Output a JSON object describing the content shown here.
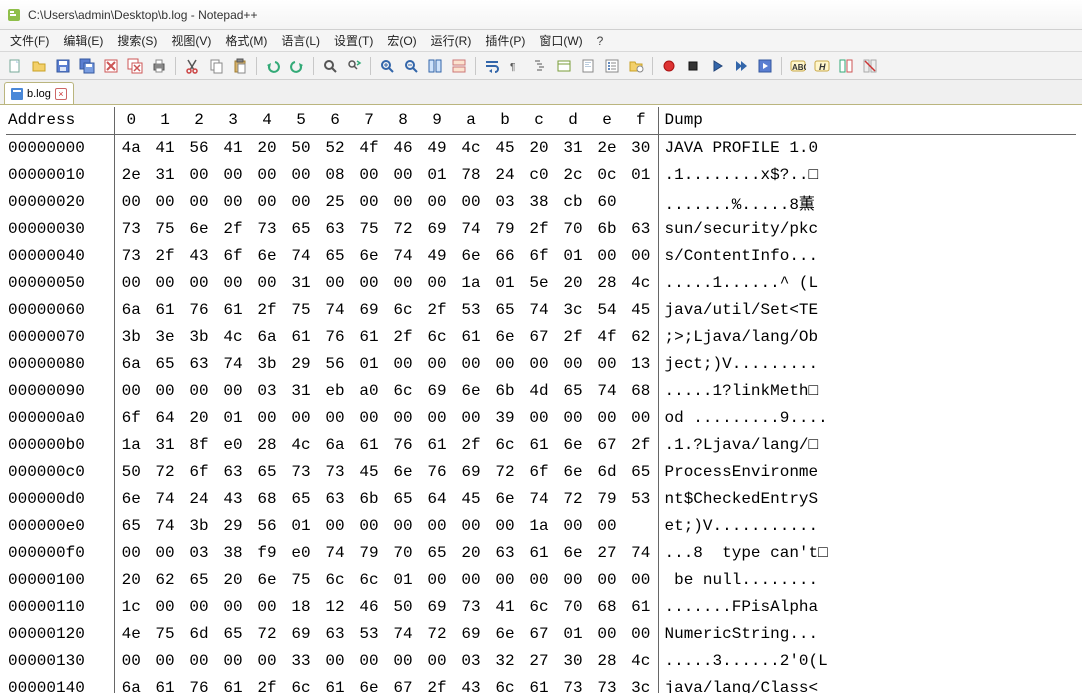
{
  "window": {
    "title": "C:\\Users\\admin\\Desktop\\b.log - Notepad++"
  },
  "menu": [
    "文件(F)",
    "编辑(E)",
    "搜索(S)",
    "视图(V)",
    "格式(M)",
    "语言(L)",
    "设置(T)",
    "宏(O)",
    "运行(R)",
    "插件(P)",
    "窗口(W)",
    "?"
  ],
  "tab": {
    "label": "b.log",
    "close": "×"
  },
  "hex": {
    "header": {
      "address": "Address",
      "cols": [
        "0",
        "1",
        "2",
        "3",
        "4",
        "5",
        "6",
        "7",
        "8",
        "9",
        "a",
        "b",
        "c",
        "d",
        "e",
        "f"
      ],
      "dump": "Dump"
    },
    "rows": [
      {
        "addr": "00000000",
        "hex": [
          "4a",
          "41",
          "56",
          "41",
          "20",
          "50",
          "52",
          "4f",
          "46",
          "49",
          "4c",
          "45",
          "20",
          "31",
          "2e",
          "30"
        ],
        "dump": "JAVA PROFILE 1.0"
      },
      {
        "addr": "00000010",
        "hex": [
          "2e",
          "31",
          "00",
          "00",
          "00",
          "00",
          "08",
          "00",
          "00",
          "01",
          "78",
          "24",
          "c0",
          "2c",
          "0c",
          "01"
        ],
        "dump": ".1........x$?..□"
      },
      {
        "addr": "00000020",
        "hex": [
          "00",
          "00",
          "00",
          "00",
          "00",
          "00",
          "25",
          "00",
          "00",
          "00",
          "00",
          "03",
          "38",
          "cb",
          "60"
        ],
        "dump": ".......%.....8薫"
      },
      {
        "addr": "00000030",
        "hex": [
          "73",
          "75",
          "6e",
          "2f",
          "73",
          "65",
          "63",
          "75",
          "72",
          "69",
          "74",
          "79",
          "2f",
          "70",
          "6b",
          "63"
        ],
        "dump": "sun/security/pkc"
      },
      {
        "addr": "00000040",
        "hex": [
          "73",
          "2f",
          "43",
          "6f",
          "6e",
          "74",
          "65",
          "6e",
          "74",
          "49",
          "6e",
          "66",
          "6f",
          "01",
          "00",
          "00"
        ],
        "dump": "s/ContentInfo..."
      },
      {
        "addr": "00000050",
        "hex": [
          "00",
          "00",
          "00",
          "00",
          "00",
          "31",
          "00",
          "00",
          "00",
          "00",
          "1a",
          "01",
          "5e",
          "20",
          "28",
          "4c"
        ],
        "dump": ".....1......^ (L"
      },
      {
        "addr": "00000060",
        "hex": [
          "6a",
          "61",
          "76",
          "61",
          "2f",
          "75",
          "74",
          "69",
          "6c",
          "2f",
          "53",
          "65",
          "74",
          "3c",
          "54",
          "45"
        ],
        "dump": "java/util/Set<TE"
      },
      {
        "addr": "00000070",
        "hex": [
          "3b",
          "3e",
          "3b",
          "4c",
          "6a",
          "61",
          "76",
          "61",
          "2f",
          "6c",
          "61",
          "6e",
          "67",
          "2f",
          "4f",
          "62"
        ],
        "dump": ";>;Ljava/lang/Ob"
      },
      {
        "addr": "00000080",
        "hex": [
          "6a",
          "65",
          "63",
          "74",
          "3b",
          "29",
          "56",
          "01",
          "00",
          "00",
          "00",
          "00",
          "00",
          "00",
          "00",
          "13"
        ],
        "dump": "ject;)V........."
      },
      {
        "addr": "00000090",
        "hex": [
          "00",
          "00",
          "00",
          "00",
          "03",
          "31",
          "eb",
          "a0",
          "6c",
          "69",
          "6e",
          "6b",
          "4d",
          "65",
          "74",
          "68"
        ],
        "dump": ".....1?linkMeth□"
      },
      {
        "addr": "000000a0",
        "hex": [
          "6f",
          "64",
          "20",
          "01",
          "00",
          "00",
          "00",
          "00",
          "00",
          "00",
          "00",
          "39",
          "00",
          "00",
          "00",
          "00"
        ],
        "dump": "od .........9...."
      },
      {
        "addr": "000000b0",
        "hex": [
          "1a",
          "31",
          "8f",
          "e0",
          "28",
          "4c",
          "6a",
          "61",
          "76",
          "61",
          "2f",
          "6c",
          "61",
          "6e",
          "67",
          "2f"
        ],
        "dump": ".1.?Ljava/lang/□"
      },
      {
        "addr": "000000c0",
        "hex": [
          "50",
          "72",
          "6f",
          "63",
          "65",
          "73",
          "73",
          "45",
          "6e",
          "76",
          "69",
          "72",
          "6f",
          "6e",
          "6d",
          "65"
        ],
        "dump": "ProcessEnvironme"
      },
      {
        "addr": "000000d0",
        "hex": [
          "6e",
          "74",
          "24",
          "43",
          "68",
          "65",
          "63",
          "6b",
          "65",
          "64",
          "45",
          "6e",
          "74",
          "72",
          "79",
          "53"
        ],
        "dump": "nt$CheckedEntryS"
      },
      {
        "addr": "000000e0",
        "hex": [
          "65",
          "74",
          "3b",
          "29",
          "56",
          "01",
          "00",
          "00",
          "00",
          "00",
          "00",
          "00",
          "1a",
          "00",
          "00"
        ],
        "dump": "et;)V..........."
      },
      {
        "addr": "000000f0",
        "hex": [
          "00",
          "00",
          "03",
          "38",
          "f9",
          "e0",
          "74",
          "79",
          "70",
          "65",
          "20",
          "63",
          "61",
          "6e",
          "27",
          "74"
        ],
        "dump": "...8  type can't□"
      },
      {
        "addr": "00000100",
        "hex": [
          "20",
          "62",
          "65",
          "20",
          "6e",
          "75",
          "6c",
          "6c",
          "01",
          "00",
          "00",
          "00",
          "00",
          "00",
          "00",
          "00"
        ],
        "dump": " be null........"
      },
      {
        "addr": "00000110",
        "hex": [
          "1c",
          "00",
          "00",
          "00",
          "00",
          "18",
          "12",
          "46",
          "50",
          "69",
          "73",
          "41",
          "6c",
          "70",
          "68",
          "61"
        ],
        "dump": ".......FPisAlpha"
      },
      {
        "addr": "00000120",
        "hex": [
          "4e",
          "75",
          "6d",
          "65",
          "72",
          "69",
          "63",
          "53",
          "74",
          "72",
          "69",
          "6e",
          "67",
          "01",
          "00",
          "00"
        ],
        "dump": "NumericString..."
      },
      {
        "addr": "00000130",
        "hex": [
          "00",
          "00",
          "00",
          "00",
          "00",
          "33",
          "00",
          "00",
          "00",
          "00",
          "03",
          "32",
          "27",
          "30",
          "28",
          "4c"
        ],
        "dump": ".....3......2'0(L"
      },
      {
        "addr": "00000140",
        "hex": [
          "6a",
          "61",
          "76",
          "61",
          "2f",
          "6c",
          "61",
          "6e",
          "67",
          "2f",
          "43",
          "6c",
          "61",
          "73",
          "73",
          "3c"
        ],
        "dump": "java/lang/Class<"
      }
    ]
  }
}
